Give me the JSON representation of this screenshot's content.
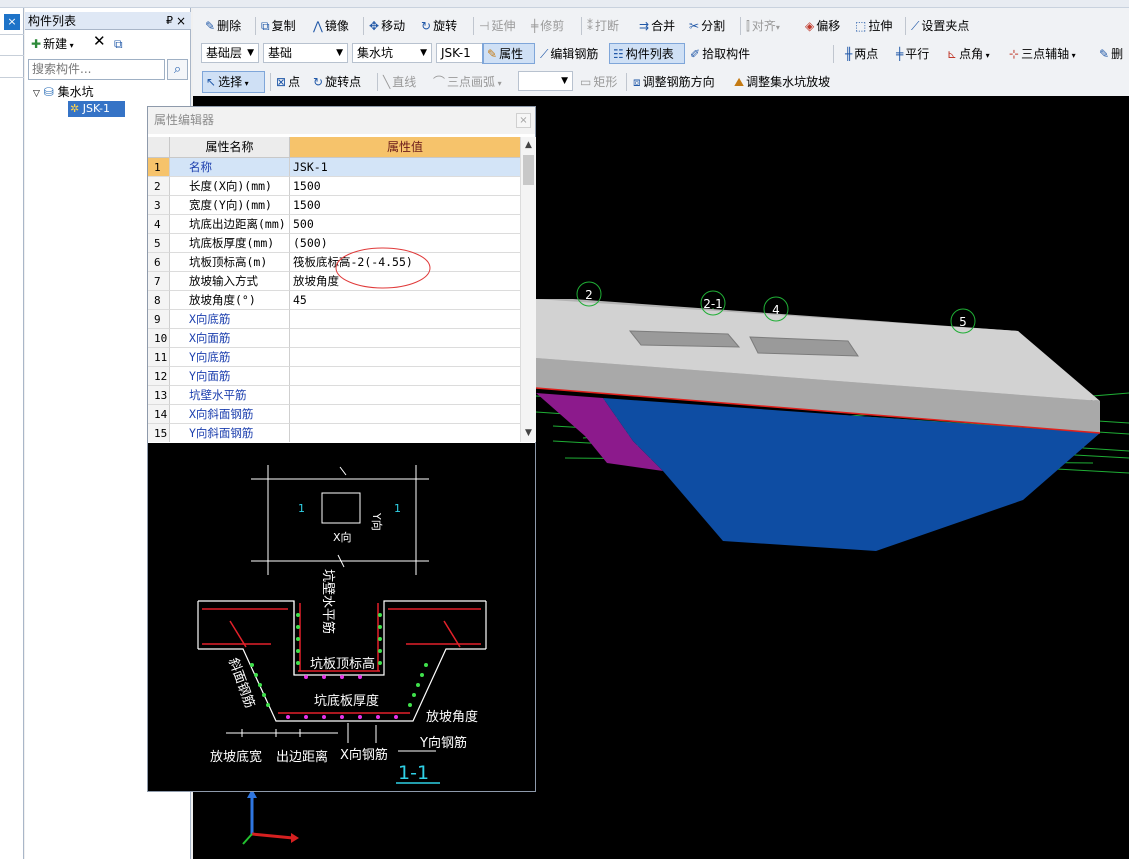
{
  "tree_panel": {
    "title": "构件列表",
    "pin_glyph": "₽",
    "close_glyph": "×",
    "new_label": "新建",
    "search_placeholder": "搜索构件...",
    "root_label": "集水坑",
    "child_label": "JSK-1"
  },
  "left_edge": {
    "close_glyph": "×"
  },
  "toolbar_row1": {
    "delete": "删除",
    "copy": "复制",
    "mirror": "镜像",
    "move": "移动",
    "rotate": "旋转",
    "extend": "延伸",
    "trim": "修剪",
    "break": "打断",
    "merge": "合并",
    "split": "分割",
    "align": "对齐",
    "offset": "偏移",
    "stretch": "拉伸",
    "set_grip": "设置夹点"
  },
  "toolbar_row2": {
    "floor": "基础层",
    "category": "基础",
    "type": "集水坑",
    "member": "JSK-1",
    "properties": "属性",
    "edit_rebar": "编辑钢筋",
    "component_list": "构件列表",
    "pick_component": "拾取构件",
    "two_points": "两点",
    "parallel": "平行",
    "point_angle": "点角",
    "three_point_aux": "三点辅轴",
    "delete_trunc": "删"
  },
  "toolbar_row3": {
    "select": "选择",
    "point": "点",
    "rotate_point": "旋转点",
    "line": "直线",
    "three_point_arc": "三点画弧",
    "rect": "矩形",
    "adjust_rebar_dir": "调整钢筋方向",
    "adjust_slope": "调整集水坑放坡"
  },
  "property_editor": {
    "title": "属性编辑器",
    "col_name": "属性名称",
    "col_value": "属性值",
    "rows": [
      {
        "no": "1",
        "name": "名称",
        "value": "JSK-1"
      },
      {
        "no": "2",
        "name": "长度(X向)(mm)",
        "value": "1500"
      },
      {
        "no": "3",
        "name": "宽度(Y向)(mm)",
        "value": "1500"
      },
      {
        "no": "4",
        "name": "坑底出边距离(mm)",
        "value": "500"
      },
      {
        "no": "5",
        "name": "坑底板厚度(mm)",
        "value": "(500)"
      },
      {
        "no": "6",
        "name": "坑板顶标高(m)",
        "value": "筏板底标高-2(-4.55)"
      },
      {
        "no": "7",
        "name": "放坡输入方式",
        "value": "放坡角度"
      },
      {
        "no": "8",
        "name": "放坡角度(°)",
        "value": "45"
      },
      {
        "no": "9",
        "name": "X向底筋",
        "value": ""
      },
      {
        "no": "10",
        "name": "X向面筋",
        "value": ""
      },
      {
        "no": "11",
        "name": "Y向底筋",
        "value": ""
      },
      {
        "no": "12",
        "name": "Y向面筋",
        "value": ""
      },
      {
        "no": "13",
        "name": "坑壁水平筋",
        "value": ""
      },
      {
        "no": "14",
        "name": "X向斜面钢筋",
        "value": ""
      },
      {
        "no": "15",
        "name": "Y向斜面钢筋",
        "value": ""
      }
    ]
  },
  "diagram": {
    "section_label": "1",
    "x_dir": "X向",
    "y_dir": "Y向",
    "wall_horizontal_bar": "坑壁水平筋",
    "top_elev": "坑板顶标高",
    "bottom_thickness": "坑底板厚度",
    "slope_angle": "放坡角度",
    "slope_rebar": "斜面钢筋",
    "slope_width": "放坡底宽",
    "edge_distance": "出边距离",
    "x_rebar": "X向钢筋",
    "y_rebar": "Y向钢筋",
    "section_title": "1-1"
  },
  "viewport": {
    "axis_labels": [
      "2",
      "2-1",
      "4",
      "5"
    ]
  }
}
